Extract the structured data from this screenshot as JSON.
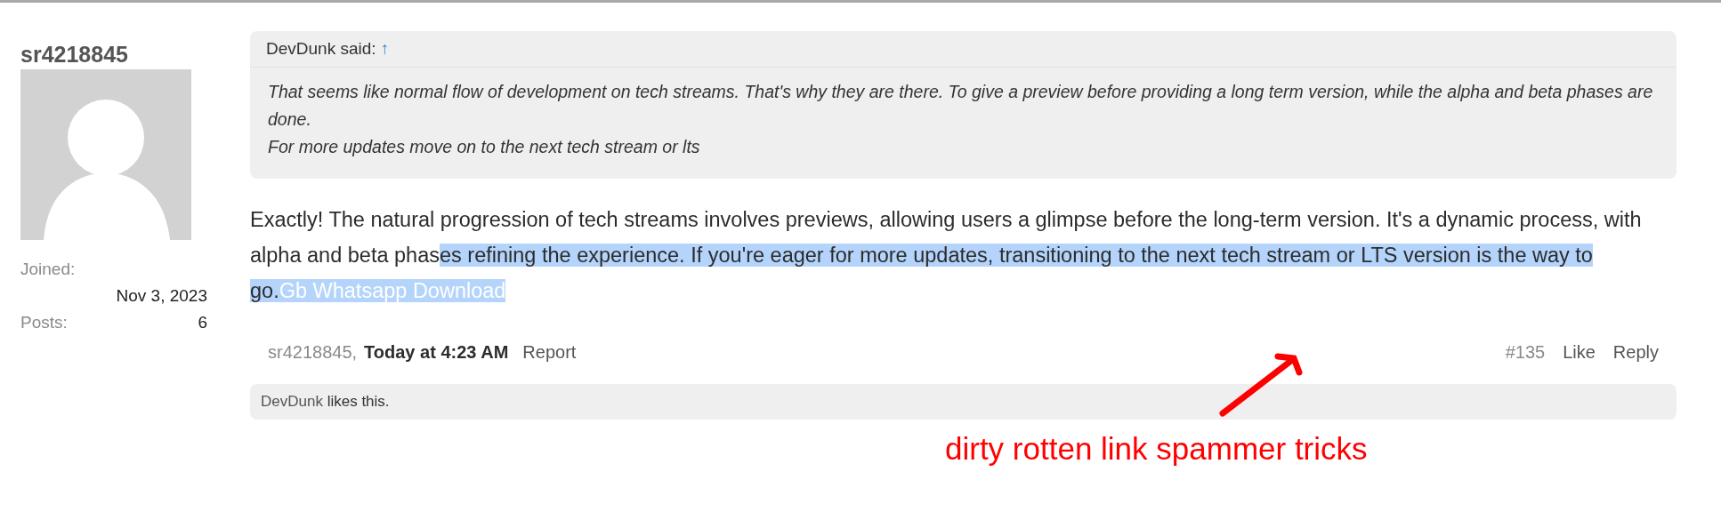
{
  "author": {
    "username": "sr4218845",
    "stats": [
      {
        "label": "Joined:",
        "value": "Nov 3, 2023",
        "kind": "stacked"
      },
      {
        "label": "Posts:",
        "value": "6",
        "kind": "inline"
      }
    ]
  },
  "quote": {
    "author": "DevDunk said:",
    "jump": "↑",
    "lines": [
      "That seems like normal flow of development on tech streams. That's why they are there. To give a preview before providing a long term version, while the alpha and beta phases are done.",
      "For more updates move on to the next tech stream or lts"
    ]
  },
  "body": [
    {
      "text": "Exactly! The natural progression of tech streams involves previews, allowing users a glimpse before the long-term version. It's a dynamic process, with alpha and beta phas",
      "kind": "text",
      "highlighted": false
    },
    {
      "text": "es refining the experience. If you're eager for more updates, transitioning to the next tech stream or LTS version is the way to go.",
      "kind": "text",
      "highlighted": true
    },
    {
      "text": "Gb Whatsapp Download",
      "kind": "link",
      "highlighted": true
    }
  ],
  "footer": {
    "author": "sr4218845,",
    "time": "Today at 4:23 AM",
    "report": "Report",
    "number": "#135",
    "actions": [
      "Like",
      "Reply"
    ]
  },
  "likes": {
    "user": "DevDunk",
    "text": "likes this."
  },
  "annotation": {
    "text": "dirty rotten link spammer tricks"
  }
}
